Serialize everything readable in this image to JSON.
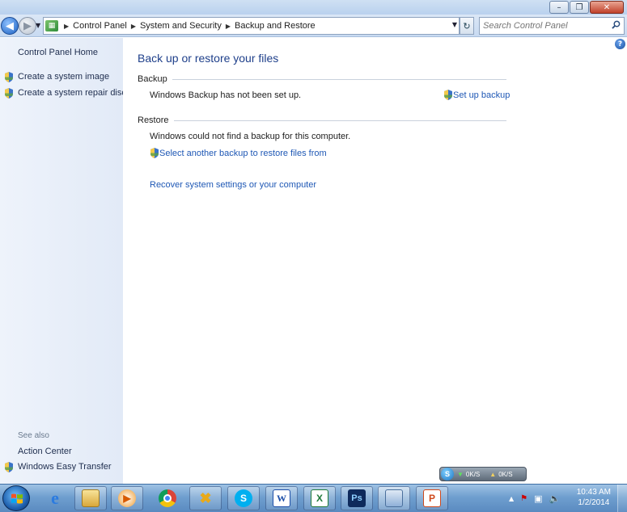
{
  "window": {
    "minimize_glyph": "–",
    "maximize_glyph": "❐",
    "close_glyph": "✕"
  },
  "nav": {
    "back_glyph": "◀",
    "forward_glyph": "▶",
    "breadcrumb": [
      "Control Panel",
      "System and Security",
      "Backup and Restore"
    ],
    "search_placeholder": "Search Control Panel"
  },
  "sidebar": {
    "home": "Control Panel Home",
    "tasks": [
      {
        "label": "Create a system image",
        "icon": "uac-shield-icon"
      },
      {
        "label": "Create a system repair disc",
        "icon": "uac-shield-icon"
      }
    ],
    "see_also_heading": "See also",
    "see_also": [
      {
        "label": "Action Center"
      },
      {
        "label": "Windows Easy Transfer",
        "icon": "uac-shield-icon"
      }
    ]
  },
  "main": {
    "title": "Back up or restore your files",
    "backup": {
      "heading": "Backup",
      "status": "Windows Backup has not been set up.",
      "setup_link": "Set up backup"
    },
    "restore": {
      "heading": "Restore",
      "status": "Windows could not find a backup for this computer.",
      "select_link": "Select another backup to restore files from",
      "recover_link": "Recover system settings or your computer"
    }
  },
  "netmeter": {
    "logo": "S",
    "down": "0K/S",
    "up": "0K/S"
  },
  "taskbar": {
    "apps": [
      {
        "name": "internet-explorer",
        "glyph": "e"
      },
      {
        "name": "windows-explorer",
        "glyph": ""
      },
      {
        "name": "media-player",
        "glyph": "▶"
      },
      {
        "name": "chrome",
        "glyph": ""
      },
      {
        "name": "unknown-app",
        "glyph": "✖"
      },
      {
        "name": "skype",
        "glyph": "S"
      },
      {
        "name": "word",
        "glyph": "W"
      },
      {
        "name": "excel",
        "glyph": "X"
      },
      {
        "name": "photoshop",
        "glyph": "Ps"
      },
      {
        "name": "control-panel",
        "glyph": ""
      },
      {
        "name": "powerpoint",
        "glyph": "P"
      }
    ],
    "clock": {
      "time": "10:43 AM",
      "date": "1/2/2014"
    },
    "tray_glyphs": {
      "expand": "▲",
      "volume": "🔈"
    }
  },
  "colors": {
    "link": "#1f58b5",
    "title": "#1e3f8a",
    "sidebar_bg": "#e6edf8"
  }
}
